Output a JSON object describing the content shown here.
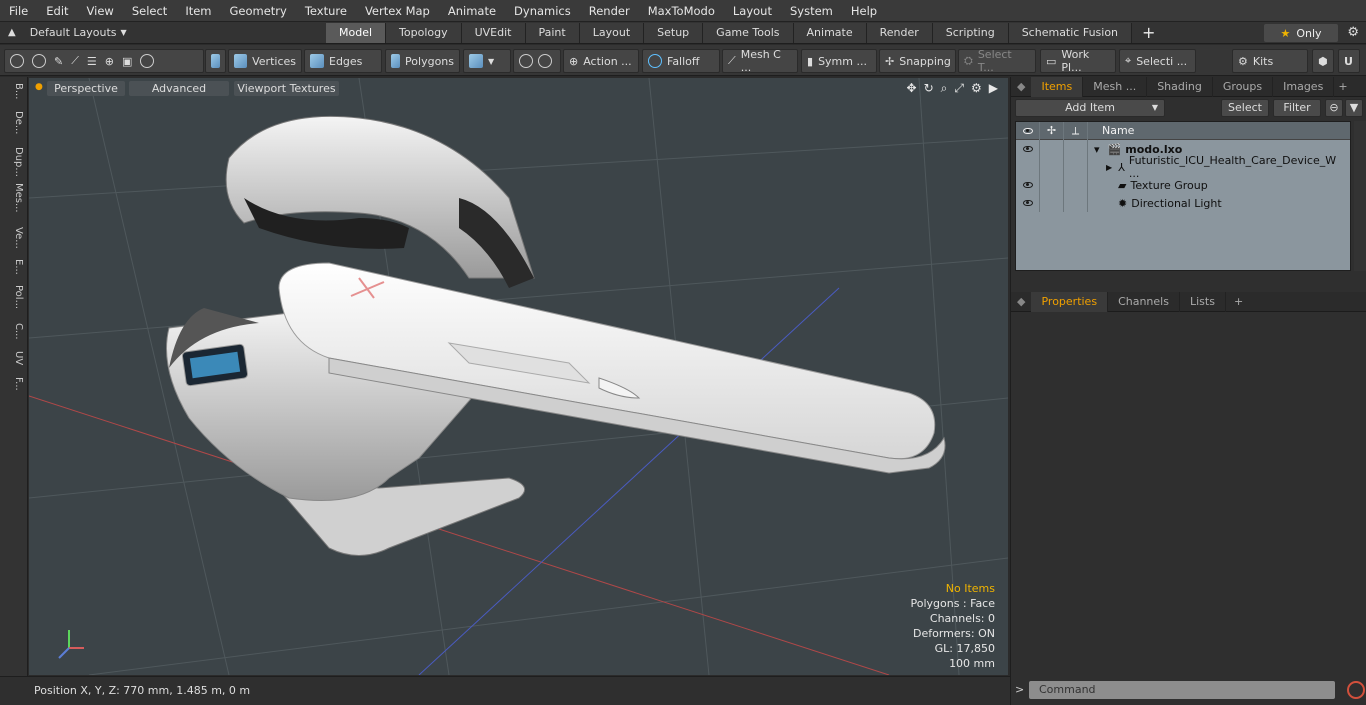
{
  "menu": [
    "File",
    "Edit",
    "View",
    "Select",
    "Item",
    "Geometry",
    "Texture",
    "Vertex Map",
    "Animate",
    "Dynamics",
    "Render",
    "MaxToModo",
    "Layout",
    "System",
    "Help"
  ],
  "layouts_label": "Default Layouts",
  "tabs": [
    "Model",
    "Topology",
    "UVEdit",
    "Paint",
    "Layout",
    "Setup",
    "Game Tools",
    "Animate",
    "Render",
    "Scripting",
    "Schematic Fusion"
  ],
  "active_tab": "Model",
  "only_label": "Only",
  "toolbar": {
    "vertices": "Vertices",
    "edges": "Edges",
    "polygons": "Polygons",
    "action": "Action ...",
    "falloff": "Falloff",
    "meshc": "Mesh C ...",
    "symm": "Symm ...",
    "snapping": "Snapping",
    "selectt": "Select T...",
    "workpl": "Work Pl...",
    "selecti": "Selecti ...",
    "kits": "Kits"
  },
  "left_tabs": [
    "B...",
    "De...",
    "Dup...",
    "Mes...",
    "Ve...",
    "E...",
    "Pol...",
    "C...",
    "UV",
    "F..."
  ],
  "viewport": {
    "perspective": "Perspective",
    "advanced": "Advanced",
    "textures": "Viewport Textures",
    "stats": {
      "no_items": "No Items",
      "polygons": "Polygons : Face",
      "channels": "Channels: 0",
      "deformers": "Deformers: ON",
      "gl": "GL: 17,850",
      "scale": "100 mm"
    }
  },
  "status": {
    "position": "Position X, Y, Z:  770 mm, 1.485 m, 0 m"
  },
  "right_panel": {
    "tabs": [
      "Items",
      "Mesh ...",
      "Shading",
      "Groups",
      "Images"
    ],
    "add_item": "Add Item",
    "select": "Select",
    "filter": "Filter",
    "name_header": "Name",
    "items": [
      {
        "name": "modo.lxo",
        "bold": true
      },
      {
        "name": "Futuristic_ICU_Health_Care_Device_W ...",
        "bold": false
      },
      {
        "name": "Texture Group",
        "bold": false
      },
      {
        "name": "Directional Light",
        "bold": false
      }
    ],
    "lower_tabs": [
      "Properties",
      "Channels",
      "Lists"
    ],
    "command_placeholder": "Command"
  },
  "colors": {
    "accent_orange": "#f0a000",
    "viewport_bg": "#3c4448",
    "record_red": "#d2503c"
  }
}
